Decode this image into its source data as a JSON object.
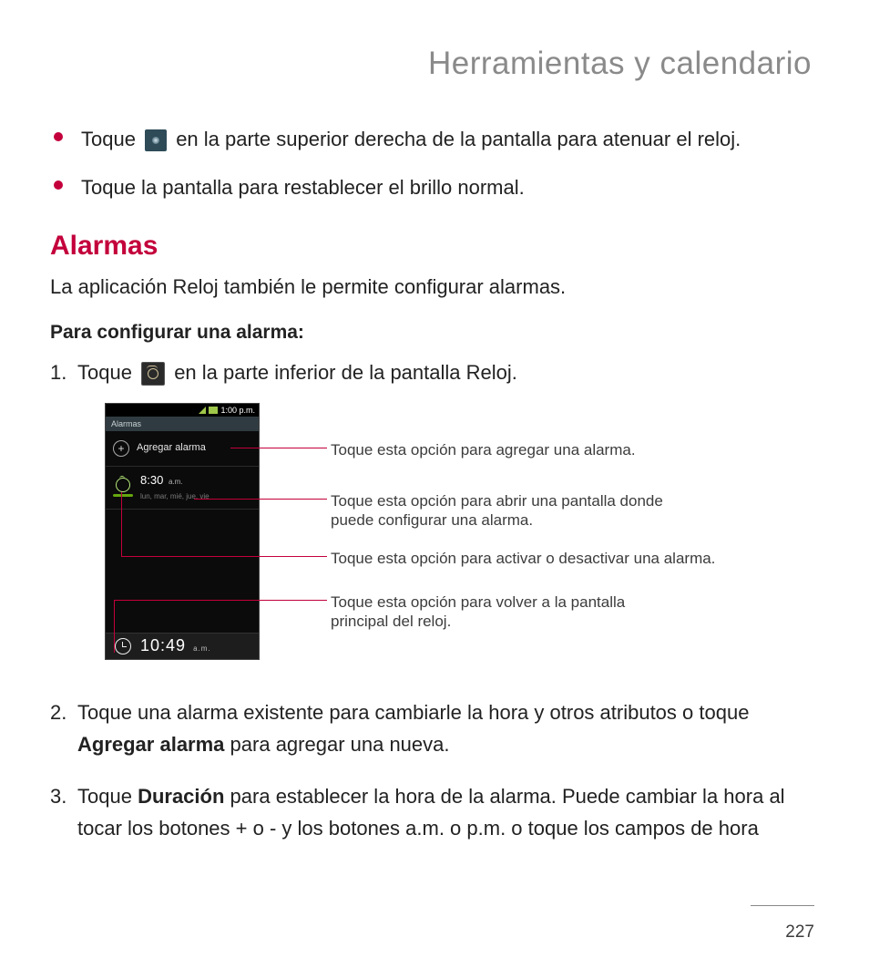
{
  "header": {
    "title": "Herramientas y calendario"
  },
  "bullets": [
    {
      "pre": "Toque ",
      "post": " en la parte superior derecha de la pantalla para atenuar el reloj.",
      "icon": "brightness-icon"
    },
    {
      "pre": "Toque la pantalla para restablecer el brillo normal.",
      "post": "",
      "icon": null
    }
  ],
  "section": {
    "heading": "Alarmas",
    "intro": "La aplicación Reloj también le permite configurar alarmas."
  },
  "subhead": "Para configurar una alarma:",
  "steps": {
    "s1_pre": "Toque ",
    "s1_post": " en la parte inferior de la pantalla Reloj.",
    "s2_pre": "Toque una alarma existente para cambiarle la hora y otros atributos o toque ",
    "s2_bold": "Agregar alarma",
    "s2_post": " para agregar una nueva.",
    "s3_pre": "Toque ",
    "s3_bold": "Duración",
    "s3_post": " para establecer la hora de la alarma. Puede cambiar la hora al tocar los botones + o - y los botones a.m. o p.m. o toque los campos de hora"
  },
  "screenshot": {
    "status_time": "1:00 p.m.",
    "tab": "Alarmas",
    "add_label": "Agregar alarma",
    "alarm_time": "8:30",
    "alarm_ampm": "a.m.",
    "alarm_days": "lun, mar, mié, jue, vie",
    "bottom_time": "10:49",
    "bottom_ampm": "a.m."
  },
  "callouts": {
    "c1": "Toque esta opción para agregar una alarma.",
    "c2a": "Toque esta opción para abrir una pantalla donde",
    "c2b": "puede configurar una alarma.",
    "c3": "Toque esta opción para activar o desactivar una alarma.",
    "c4a": "Toque esta opción para volver a la pantalla",
    "c4b": "principal del reloj."
  },
  "page_number": "227"
}
